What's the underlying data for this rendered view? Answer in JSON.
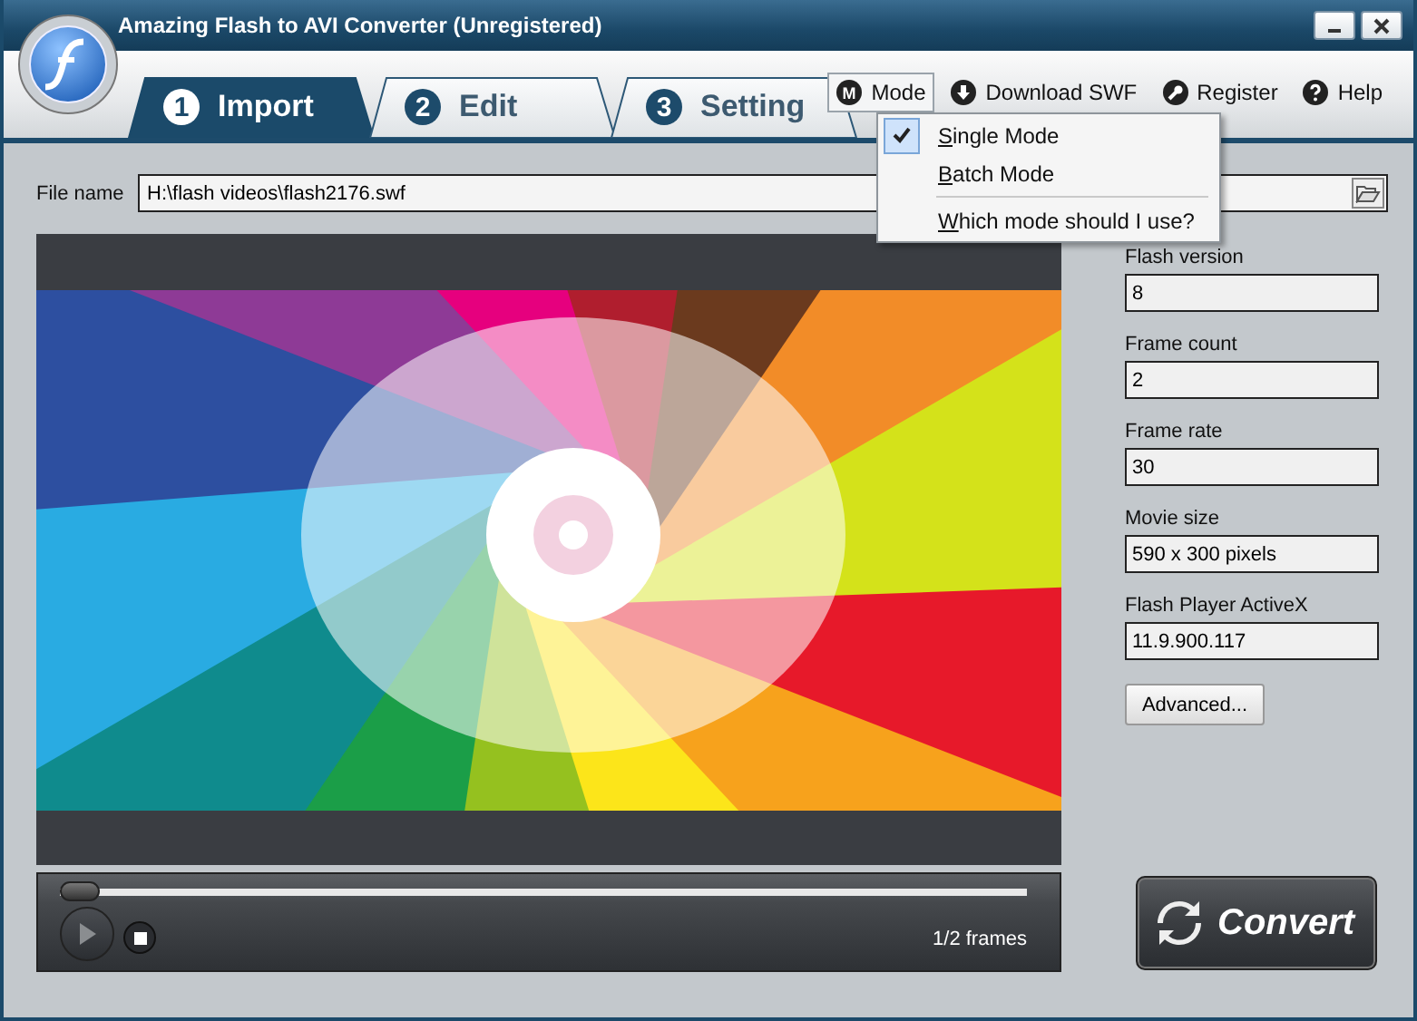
{
  "window": {
    "title": "Amazing Flash to AVI Converter (Unregistered)"
  },
  "tabs": [
    {
      "number": "1",
      "label": "Import",
      "selected": true
    },
    {
      "number": "2",
      "label": "Edit",
      "selected": false
    },
    {
      "number": "3",
      "label": "Setting",
      "selected": false
    }
  ],
  "toolbar": [
    {
      "kind": "mode",
      "badge": "M",
      "label": "Mode",
      "selected": true
    },
    {
      "kind": "download",
      "label": "Download SWF",
      "selected": false
    },
    {
      "kind": "register",
      "label": "Register",
      "selected": false
    },
    {
      "kind": "help",
      "label": "Help",
      "selected": false
    }
  ],
  "mode_menu": {
    "items": [
      {
        "kind": "option",
        "label": "Single Mode",
        "checked": true
      },
      {
        "kind": "option",
        "label": "Batch Mode",
        "checked": false
      },
      {
        "kind": "help",
        "label": "Which mode should I use?",
        "checked": false
      }
    ]
  },
  "file": {
    "label": "File name",
    "value": "H:\\flash videos\\flash2176.swf"
  },
  "player": {
    "position": {
      "level": 0
    },
    "frames": "1/2 frames"
  },
  "info": [
    {
      "label": "Flash version",
      "value": "8"
    },
    {
      "label": "Frame count",
      "value": "2"
    },
    {
      "label": "Frame rate",
      "value": "30"
    },
    {
      "label": "Movie size",
      "value": "590 x 300 pixels"
    },
    {
      "label": "Flash Player ActiveX",
      "value": "11.9.900.117"
    }
  ],
  "advanced_button": "Advanced...",
  "convert_button": "Convert"
}
